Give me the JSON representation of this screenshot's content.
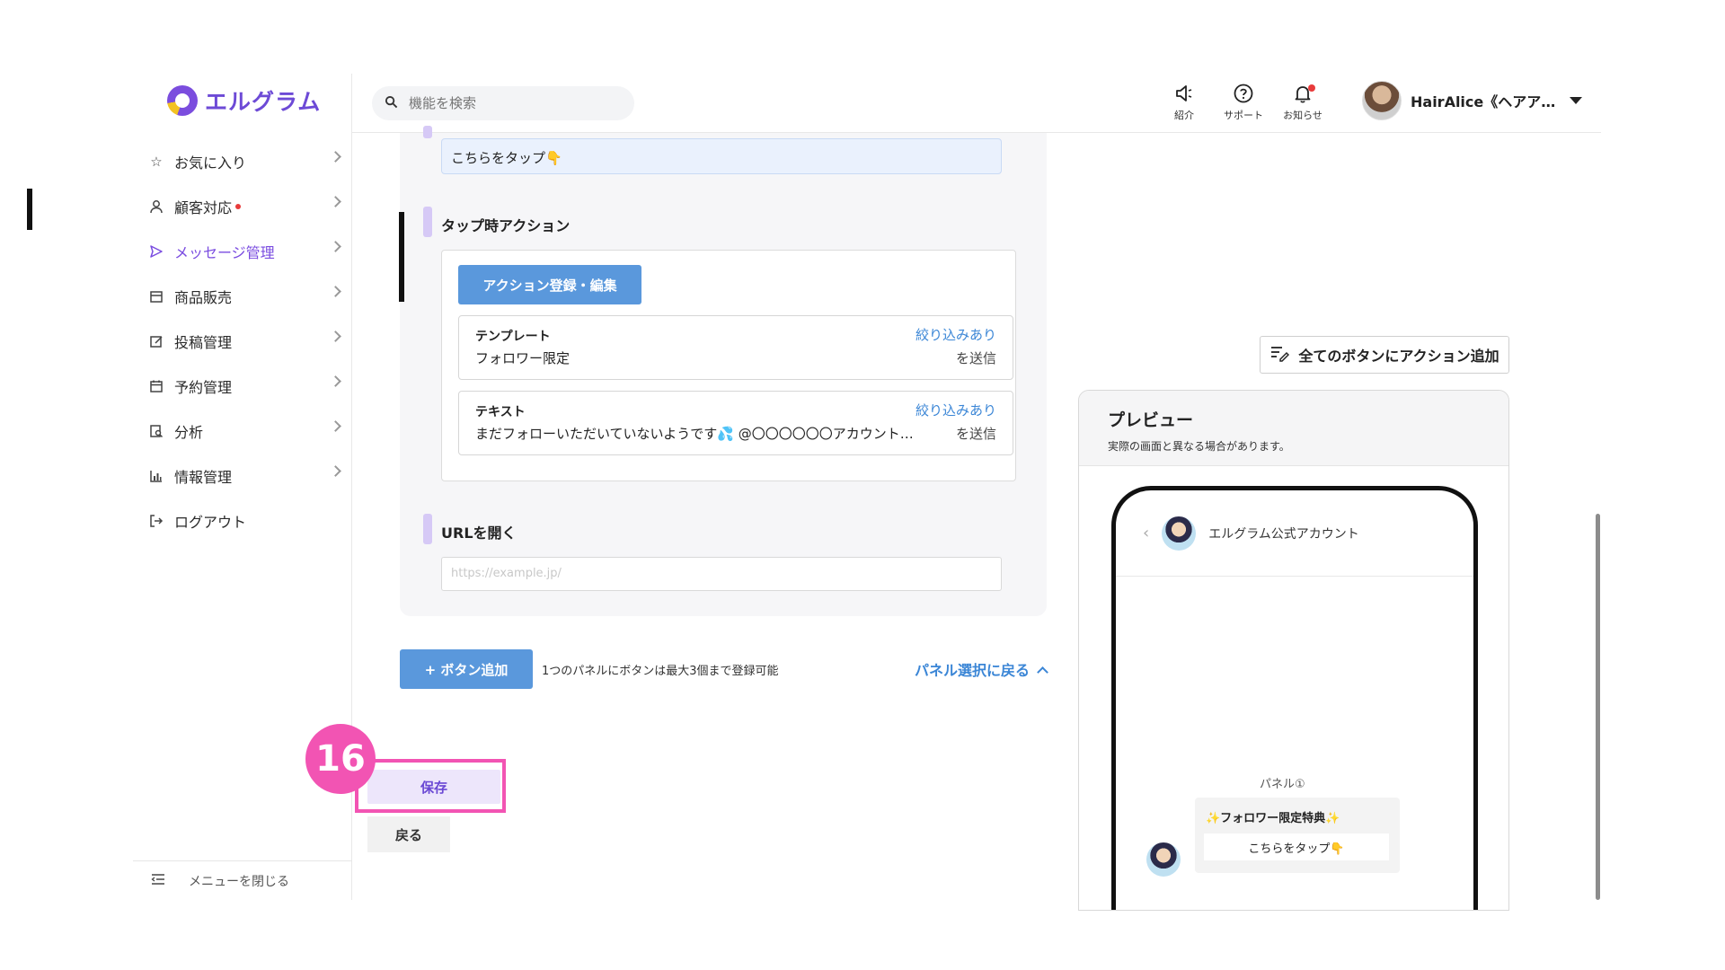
{
  "app": {
    "logo_text": "エルグラム",
    "brand_color": "#7b4dde"
  },
  "sidebar": {
    "items": [
      {
        "label": "お気に入り",
        "icon": "star-icon"
      },
      {
        "label": "顧客対応",
        "icon": "user-icon",
        "has_dot": true
      },
      {
        "label": "メッセージ管理",
        "icon": "send-icon",
        "active": true
      },
      {
        "label": "商品販売",
        "icon": "store-icon"
      },
      {
        "label": "投稿管理",
        "icon": "edit-icon"
      },
      {
        "label": "予約管理",
        "icon": "calendar-icon"
      },
      {
        "label": "分析",
        "icon": "analysis-icon"
      },
      {
        "label": "情報管理",
        "icon": "chart-icon"
      },
      {
        "label": "ログアウト",
        "icon": "logout-icon"
      }
    ],
    "close_label": "メニューを閉じる"
  },
  "header": {
    "search_placeholder": "機能を検索",
    "intro_label": "紹介",
    "support_label": "サポート",
    "notice_label": "お知らせ",
    "user_name": "HairAlice《ヘアア…"
  },
  "editor": {
    "button_text_value": "こちらをタップ👇",
    "tap_action_title": "タップ時アクション",
    "action_register_label": "アクション登録・編集",
    "actions": [
      {
        "type": "テンプレート",
        "value": "フォロワー限定",
        "filter": "絞り込みあり",
        "send": "を送信"
      },
      {
        "type": "テキスト",
        "value": "まだフォローいただいていないようです💦 @〇〇〇〇〇〇アカウント…",
        "filter": "絞り込みあり",
        "send": "を送信"
      }
    ],
    "url_title": "URLを開く",
    "url_placeholder": "https://example.jp/"
  },
  "add_button": {
    "label": "+ ボタン追加",
    "note": "1つのパネルにボタンは最大3個まで登録可能",
    "back_to_panel": "パネル選択に戻る"
  },
  "step_number": "16",
  "save_label": "保存",
  "back_label": "戻る",
  "all_action_label": "全てのボタンにアクション追加",
  "preview": {
    "title": "プレビュー",
    "subtitle": "実際の画面と異なる場合があります。",
    "account_name": "エルグラム公式アカウント",
    "panel_label": "パネル①",
    "message_title": "✨フォロワー限定特典✨",
    "message_button": "こちらをタップ👇"
  },
  "colors": {
    "accent_blue": "#5a98dc",
    "link_blue": "#3b86d6",
    "highlight_pink": "#f254b3",
    "active_purple": "#7a4ce0"
  }
}
